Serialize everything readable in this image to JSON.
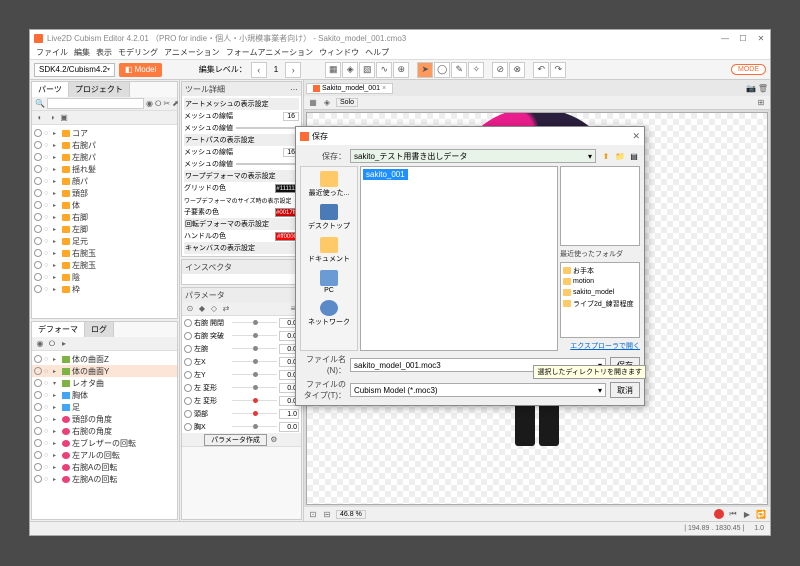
{
  "window": {
    "title": "Live2D Cubism Editor 4.2.01  （PRO for indie・個人・小規模事業者向け） - Sakito_model_001.cmo3"
  },
  "menu": [
    "ファイル",
    "編集",
    "表示",
    "モデリング",
    "アニメーション",
    "フォームアニメーション",
    "ウィンドウ",
    "ヘルプ"
  ],
  "toolbar": {
    "sdk_select": "SDK4.2/Cubism4.2",
    "model_btn": "Model",
    "level_label": "編集レベル：",
    "level_value": "1",
    "right_badge": "MODE"
  },
  "parts": {
    "tabs": [
      "パーツ",
      "プロジェクト"
    ],
    "search_placeholder": "",
    "items": [
      {
        "label": "コア",
        "folder": true
      },
      {
        "label": "右腕パ",
        "folder": true
      },
      {
        "label": "左腕パ",
        "folder": true
      },
      {
        "label": "揺れ髪",
        "folder": true
      },
      {
        "label": "顔パ",
        "folder": true
      },
      {
        "label": "頭部",
        "folder": true
      },
      {
        "label": "体",
        "folder": true
      },
      {
        "label": "右脚",
        "folder": true
      },
      {
        "label": "左脚",
        "folder": true
      },
      {
        "label": "足元",
        "folder": true
      },
      {
        "label": "右腕玉",
        "folder": true
      },
      {
        "label": "左腕玉",
        "folder": true
      },
      {
        "label": "陰",
        "folder": true
      },
      {
        "label": "枠",
        "folder": true
      }
    ]
  },
  "deform": {
    "tabs": [
      "デフォーマ",
      "ログ"
    ],
    "items": [
      {
        "label": "体の曲面Z",
        "type": "warp"
      },
      {
        "label": "体の曲面Y",
        "type": "warp",
        "sel": true
      },
      {
        "label": "レオタ曲",
        "type": "warp",
        "exp": true
      },
      {
        "label": "胸体",
        "type": "artm"
      },
      {
        "label": "足",
        "type": "artm"
      },
      {
        "label": "頭部の角度",
        "type": "rot"
      },
      {
        "label": "右腕の角度",
        "type": "rot"
      },
      {
        "label": "左ブレザーの回転",
        "type": "rot"
      },
      {
        "label": "左アルの回転",
        "type": "rot"
      },
      {
        "label": "右腕Aの回転",
        "type": "rot"
      },
      {
        "label": "左腕Aの回転",
        "type": "rot"
      }
    ]
  },
  "tool_detail": {
    "header": "ツール詳細",
    "section1": "アートメッシュの表示設定",
    "mesh_lines": "メッシュの線幅",
    "mesh_lines_val": "16",
    "mesh_opacity": "メッシュの線値",
    "section2": "アートパスの表示設定",
    "section3": "ワープデフォーマの表示設定",
    "grid_color": "グリッドの色",
    "grid_color_val": "#111111",
    "bezier": "ワープデフォーマのサイズ時の表示設定",
    "child_color": "子要素の色",
    "child_color_val": "#0017ff0033",
    "section4": "回転デフォーマの表示設定",
    "handle_color": "ハンドルの色",
    "handle_color_val": "#ff0000",
    "section5": "キャンバスの表示設定"
  },
  "inspector": {
    "header": "インスペクタ"
  },
  "parameters": {
    "header": "パラメータ",
    "items": [
      {
        "name": "右腕 開閉",
        "val": "0.0"
      },
      {
        "name": "右腕 突破",
        "val": "0.0"
      },
      {
        "name": "左腕",
        "val": "0.0"
      },
      {
        "name": "左X",
        "val": "0.0"
      },
      {
        "name": "左Y",
        "val": "0.0"
      },
      {
        "name": "左 変形",
        "val": "0.0"
      },
      {
        "name": "左 変形",
        "val": "0.0",
        "red": true
      },
      {
        "name": "頭部",
        "val": "1.0",
        "red": true
      },
      {
        "name": "胸X",
        "val": "0.0"
      }
    ],
    "footer_btn": "パラメータ作成"
  },
  "canvas": {
    "tab_name": "Sakito_model_001",
    "solo_label": "Solo",
    "zoom": "46.8 %",
    "status_coords": "| 194.89 . 1830.45 |",
    "status_cursor": "1.0"
  },
  "dialog": {
    "title": "保存",
    "save_in_label": "保存：",
    "save_in_value": "sakito_テスト用書き出しデータ",
    "selected_file": "sakito_001",
    "side_items": [
      "最近使った...",
      "デスクトップ",
      "ドキュメント",
      "PC",
      "ネットワーク"
    ],
    "recent_label": "最近使ったフォルダ",
    "recent_items": [
      "お手本",
      "motion",
      "sakito_model",
      "ライブ2d_練習程度"
    ],
    "explorer_link": "エクスプローラで開く",
    "filename_label": "ファイル名(N)：",
    "filename_value": "sakito_model_001.moc3",
    "filetype_label": "ファイルのタイプ(T)：",
    "filetype_value": "Cubism Model (*.moc3)",
    "save_btn": "保存",
    "cancel_btn": "取消",
    "tooltip": "選択したディレクトリを開きます"
  }
}
